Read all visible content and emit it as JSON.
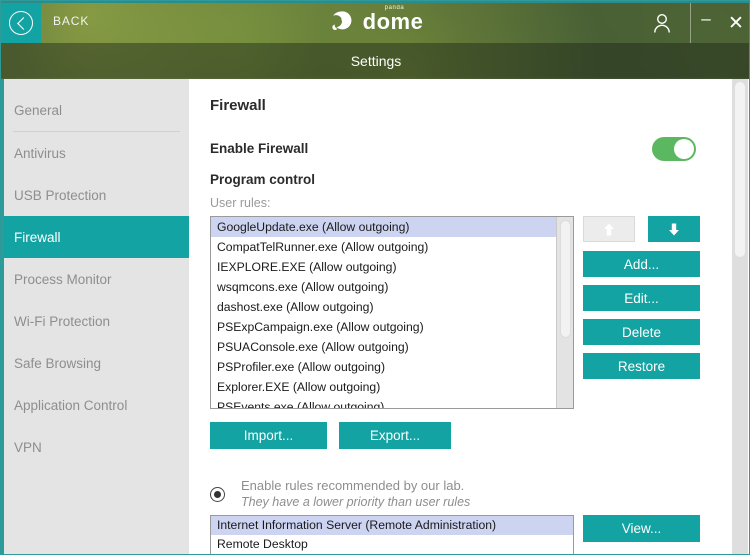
{
  "titlebar": {
    "back_label": "BACK",
    "back_icon": "chevron-left-circle-icon",
    "logo_sub": "panda",
    "logo_word": "dome",
    "logo_icon": "panda-logo-icon",
    "user_icon": "user-account-icon",
    "minimize_label": "–",
    "close_label": "✕",
    "settings_title": "Settings",
    "accent": "#13a3a3"
  },
  "sidebar": {
    "items": [
      {
        "label": "General",
        "active": false
      },
      {
        "label": "Antivirus",
        "active": false
      },
      {
        "label": "USB Protection",
        "active": false
      },
      {
        "label": "Firewall",
        "active": true
      },
      {
        "label": "Process Monitor",
        "active": false
      },
      {
        "label": "Wi-Fi Protection",
        "active": false
      },
      {
        "label": "Safe Browsing",
        "active": false
      },
      {
        "label": "Application Control",
        "active": false
      },
      {
        "label": "VPN",
        "active": false
      }
    ]
  },
  "main": {
    "page_title": "Firewall",
    "enable_firewall_label": "Enable Firewall",
    "enable_firewall_on": true,
    "toggle_color": "#5cb860",
    "program_control_label": "Program control",
    "user_rules_label": "User rules:",
    "user_rules": [
      "GoogleUpdate.exe (Allow outgoing)",
      "CompatTelRunner.exe (Allow outgoing)",
      "IEXPLORE.EXE (Allow outgoing)",
      "wsqmcons.exe (Allow outgoing)",
      "dashost.exe (Allow outgoing)",
      "PSExpCampaign.exe (Allow outgoing)",
      "PSUAConsole.exe (Allow outgoing)",
      "PSProfiler.exe (Allow outgoing)",
      "Explorer.EXE (Allow outgoing)",
      "PSEvents.exe (Allow outgoing)"
    ],
    "selected_user_rule_index": 0,
    "move_up_icon": "arrow-up-icon",
    "move_down_icon": "arrow-down-icon",
    "move_up_enabled": false,
    "move_down_enabled": true,
    "buttons": {
      "add": "Add...",
      "edit": "Edit...",
      "delete": "Delete",
      "restore": "Restore",
      "import": "Import...",
      "export": "Export...",
      "view": "View..."
    },
    "recommended": {
      "selected": true,
      "line1": "Enable rules recommended by our lab.",
      "line2": "They have a lower priority than user rules",
      "rules": [
        "Internet Information Server (Remote Administration)",
        "Remote Desktop"
      ],
      "selected_index": 0
    }
  }
}
